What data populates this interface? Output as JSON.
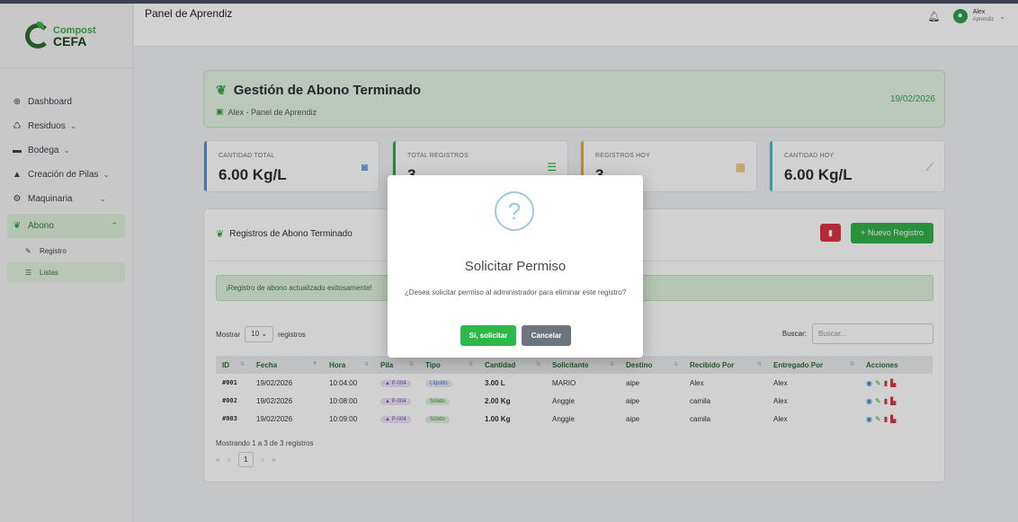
{
  "brand": {
    "line1": "Compost",
    "line2": "CEFA"
  },
  "header": {
    "title": "Panel de Aprendiz",
    "user_name": "Alex",
    "user_role": "Aprendiz"
  },
  "sidebar": {
    "items": [
      {
        "label": "Dashboard",
        "icon": "dashboard-icon"
      },
      {
        "label": "Residuos",
        "icon": "recycle-icon"
      },
      {
        "label": "Bodega",
        "icon": "warehouse-icon"
      },
      {
        "label": "Creación de Pilas",
        "icon": "pile-icon"
      },
      {
        "label": "Maquinaria",
        "icon": "gears-icon"
      },
      {
        "label": "Abono",
        "icon": "seedling-icon"
      }
    ],
    "subitems": [
      {
        "label": "Registro",
        "icon": "edit-icon"
      },
      {
        "label": "Listas",
        "icon": "list-icon"
      }
    ]
  },
  "banner": {
    "title": "Gestión de Abono Terminado",
    "subtitle": "Alex - Panel de Aprendiz",
    "date": "19/02/2026"
  },
  "cards": [
    {
      "label": "CANTIDAD TOTAL",
      "value": "6.00 Kg/L",
      "color": "#5b8fd6"
    },
    {
      "label": "TOTAL REGISTROS",
      "value": "3",
      "color": "#36a64a"
    },
    {
      "label": "REGISTROS HOY",
      "value": "3",
      "color": "#e0b33a"
    },
    {
      "label": "CANTIDAD HOY",
      "value": "6.00 Kg/L",
      "color": "#5bb5c9"
    }
  ],
  "panel": {
    "title": "Registros de Abono Terminado",
    "new_label": "+ Nuevo Registro",
    "alert": "¡Registro de abono actualizado exitosamente!",
    "show_prefix": "Mostrar",
    "show_value": "10",
    "show_suffix": "registros",
    "search_label": "Buscar:",
    "search_placeholder": "Buscar...",
    "showing": "Mostrando 1 a 3 de 3 registros",
    "page": "1"
  },
  "table": {
    "headers": [
      "ID",
      "Fecha",
      "Hora",
      "Pila",
      "Tipo",
      "Cantidad",
      "Solicitante",
      "Destino",
      "Recibido Por",
      "Entregado Por",
      "Acciones"
    ],
    "rows": [
      [
        "#001",
        "19/02/2026",
        "10:04:00",
        "P-004",
        "Líquido",
        "3.00 L",
        "MARIO",
        "aipe",
        "Alex",
        "Alex"
      ],
      [
        "#002",
        "19/02/2026",
        "10:08:00",
        "P-004",
        "Sólido",
        "2.00 Kg",
        "Anggie",
        "aipe",
        "camila",
        "Alex"
      ],
      [
        "#003",
        "19/02/2026",
        "10:09:00",
        "P-004",
        "Sólido",
        "1.00 Kg",
        "Anggie",
        "aipe",
        "camila",
        "Alex"
      ]
    ]
  },
  "modal": {
    "title": "Solicitar Permiso",
    "text": "¿Desea solicitar permiso al administrador para eliminar este registro?",
    "confirm": "Sí, solicitar",
    "cancel": "Cancelar"
  },
  "colors": {
    "primary": "#34b04a",
    "danger": "#dc3545",
    "sidebar_active": "#dff0dc"
  }
}
